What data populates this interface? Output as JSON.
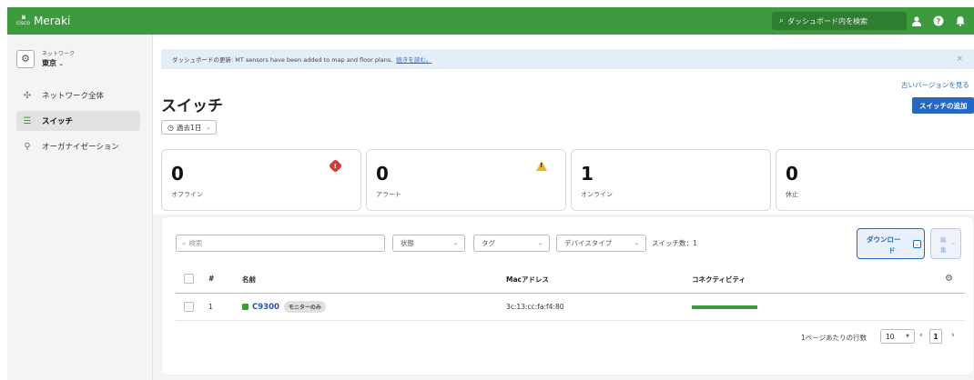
{
  "header": {
    "brand_small": "cisco",
    "brand": "Meraki",
    "search_placeholder": "ダッシュボード内を検索"
  },
  "sidebar": {
    "network_label": "ネットワーク",
    "network_value": "東京",
    "items": [
      {
        "label": "ネットワーク全体",
        "icon": "network-wide-icon",
        "active": false
      },
      {
        "label": "スイッチ",
        "icon": "switch-icon",
        "active": true
      },
      {
        "label": "オーガナイゼーション",
        "icon": "organization-icon",
        "active": false
      }
    ]
  },
  "banner": {
    "text": "ダッシュボードの更新: MT sensors have been added to map and floor plans.",
    "link": "続きを読む。"
  },
  "page": {
    "title": "スイッチ",
    "time_range": "過去1日",
    "old_version_link": "古いバージョンを見る",
    "add_button": "スイッチの追加"
  },
  "cards": [
    {
      "value": "0",
      "label": "オフライン",
      "badge": "error"
    },
    {
      "value": "0",
      "label": "アラート",
      "badge": "warning"
    },
    {
      "value": "1",
      "label": "オンライン",
      "badge": ""
    },
    {
      "value": "0",
      "label": "休止",
      "badge": ""
    }
  ],
  "filters": {
    "search_placeholder": "検索",
    "status": "状態",
    "tag": "タグ",
    "device_type": "デバイスタイプ",
    "count_text": "スイッチ数：1",
    "download_line1": "ダウンロー",
    "download_line2": "ド",
    "edit_line1": "編",
    "edit_line2": "集"
  },
  "table": {
    "columns": [
      "#",
      "名前",
      "Macアドレス",
      "コネクティビティ"
    ],
    "rows": [
      {
        "num": "1",
        "name": "C9300",
        "badge": "モニターのみ",
        "mac": "3c:13:cc:fa:f4:80",
        "connectivity": 1.0
      }
    ]
  },
  "pagination": {
    "rows_label": "1ページあたりの行数",
    "rows_value": "10",
    "page": "1"
  },
  "colors": {
    "brand_green": "#3d9a3f",
    "primary_blue": "#2468c2",
    "error_red": "#d43a3a",
    "warning_yellow": "#e8b52a"
  }
}
